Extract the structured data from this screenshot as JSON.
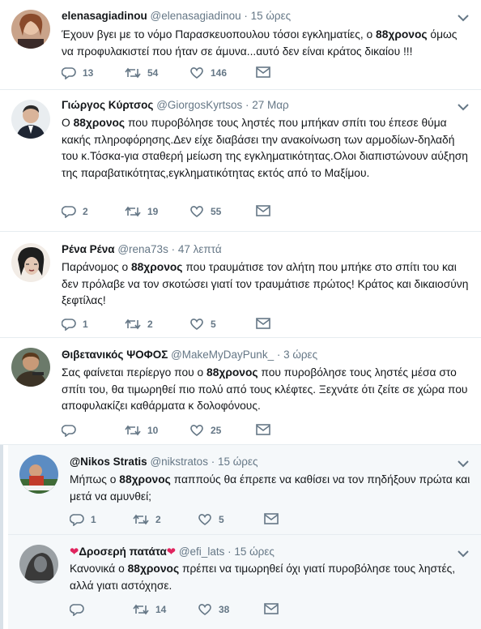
{
  "colors": {
    "muted": "#657786",
    "text": "#14171a",
    "separator": "#e6ecf0",
    "dim_background": "#f5f8fa"
  },
  "icons": {
    "reply": "reply-icon",
    "retweet": "retweet-icon",
    "like": "heart-icon",
    "dm": "envelope-icon",
    "menu": "chevron-down-icon"
  },
  "tweets": [
    {
      "name": "elenasagiadinou",
      "handle": "@elenasagiadinou",
      "time": "15 ώρες",
      "text_before": "Έχουν βγει με το νόμο  Παρασκευοπουλου τόσοι εγκληματίες, ο ",
      "bold": "88χρονος",
      "text_after": " όμως να προφυλακιστεί που ήταν σε άμυνα...αυτό δεν είναι κράτος δικαίου !!!",
      "replies": "13",
      "retweets": "54",
      "likes": "146"
    },
    {
      "name": "Γιώργος Κύρτσος",
      "handle": "@GiorgosKyrtsos",
      "time": "27 Μαρ",
      "text_before": "Ο ",
      "bold": "88χρονος",
      "text_after": " που πυροβόλησε τους ληστές που μπήκαν σπίτι του έπεσε θύμα κακής πληροφόρησης.Δεν είχε διαβάσει την ανακοίνωση των αρμοδίων-δηλαδή του κ.Τόσκα-για σταθερή μείωση της εγκληματικότητας.Ολοι διαπιστώνουν αύξηση της παραβατικότητας,εγκληματικότητας εκτός από το Μαξίμου.",
      "replies": "2",
      "retweets": "19",
      "likes": "55"
    },
    {
      "name": "Ρένα Ρένα",
      "handle": "@rena73s",
      "time": "47 λεπτά",
      "text_before": "Παράνομος ο ",
      "bold": "88χρονος",
      "text_after": " που τραυμάτισε τον αλήτη που μπήκε στο σπίτι του και δεν πρόλαβε να τον σκοτώσει γιατί τον τραυμάτισε πρώτος! Κράτος και δικαιοσύνη ξεφτίλας!",
      "replies": "1",
      "retweets": "2",
      "likes": "5"
    },
    {
      "name": "Θιβετανικός ΨΟΦΟΣ",
      "handle": "@MakeMyDayPunk_",
      "time": "3 ώρες",
      "text_before": "Σας φαίνεται περίεργο που ο ",
      "bold": "88χρονος",
      "text_after": " που πυροβόλησε τους ληστές μέσα στο σπίτι του, θα τιμωρηθεί πιο πολύ από τους κλέφτες. Ξεχνάτε ότι ζείτε σε χώρα που αποφυλακίζει καθάρματα κ δολοφόνους.",
      "replies": "",
      "retweets": "10",
      "likes": "25"
    },
    {
      "name": "@Nikos Stratis",
      "handle": "@nikstratos",
      "time": "15 ώρες",
      "text_before": "Μήπως ο ",
      "bold": "88χρονος",
      "text_after": " παππούς θα έπρεπε να καθίσει να τον πηδήξουν πρώτα και μετά να αμυνθεί;",
      "replies": "1",
      "retweets": "2",
      "likes": "5"
    },
    {
      "name": "Δροσερή πατάτα",
      "handle": "@efi_lats",
      "time": "15 ώρες",
      "text_before": "Κανονικά ο ",
      "bold": "88χρονος",
      "text_after": " πρέπει να τιμωρηθεί όχι γιατί πυροβόλησε τους ληστές, αλλά γιατι αστόχησε.",
      "replies": "",
      "retweets": "14",
      "likes": "38"
    }
  ]
}
